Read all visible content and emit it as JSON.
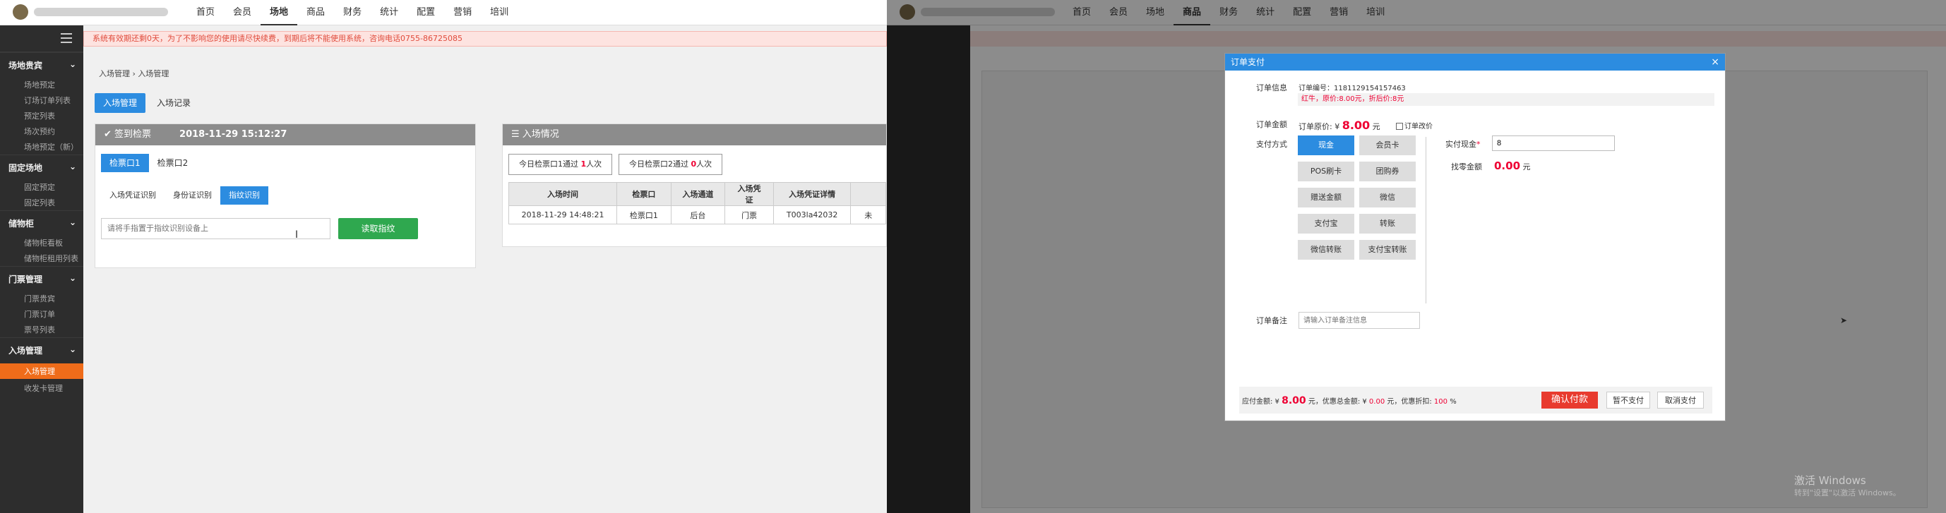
{
  "nav": {
    "items": [
      "首页",
      "会员",
      "场地",
      "商品",
      "财务",
      "统计",
      "配置",
      "营销",
      "培训"
    ],
    "active_left": "场地",
    "active_right": "商品"
  },
  "alert": "系统有效期还剩0天，为了不影响您的使用请尽快续费，到期后将不能使用系统，咨询电话0755-86725085",
  "sidebar": {
    "groups": [
      {
        "title": "场地贵宾",
        "items": [
          "场地预定",
          "订场订单列表",
          "预定列表",
          "场次预约",
          "场地预定（新）"
        ]
      },
      {
        "title": "固定场地",
        "items": [
          "固定预定",
          "固定列表"
        ]
      },
      {
        "title": "储物柜",
        "items": [
          "储物柜看板",
          "储物柜租用列表"
        ]
      },
      {
        "title": "门票管理",
        "items": [
          "门票贵宾",
          "门票订单",
          "票号列表"
        ]
      },
      {
        "title": "入场管理",
        "items": [
          "入场管理",
          "收发卡管理"
        ]
      }
    ],
    "active": "入场管理"
  },
  "breadcrumb": "入场管理 › 入场管理",
  "tabs": [
    "入场管理",
    "入场记录"
  ],
  "check_panel": {
    "title": "签到检票",
    "datetime": "2018-11-29 15:12:27",
    "gates": [
      "检票口1",
      "检票口2"
    ],
    "methods": [
      "入场凭证识别",
      "身份证识别",
      "指纹识别"
    ],
    "placeholder": "请将手指置于指纹识别设备上",
    "read_btn": "读取指纹"
  },
  "entry_panel": {
    "title": "入场情况",
    "stat1": {
      "pre": "今日检票口1通过 ",
      "count": "1",
      "post": "人次"
    },
    "stat2": {
      "pre": "今日检票口2通过 ",
      "count": "0",
      "post": "人次"
    },
    "headers": [
      "入场时间",
      "检票口",
      "入场通道",
      "入场凭证",
      "入场凭证详情"
    ],
    "rows": [
      [
        "2018-11-29 14:48:21",
        "检票口1",
        "后台",
        "门票",
        "T003la42032"
      ]
    ],
    "trail": "未"
  },
  "modal": {
    "title": "订单支付",
    "close": "×",
    "order_info_label": "订单信息",
    "order_no": "订单编号：1181129154157463",
    "discount_line": "红牛，原价:8.00元，折后价:8元",
    "amount_label": "订单金额",
    "amount_pre": "订单原价: ¥ ",
    "amount": "8.00",
    "amount_post": " 元",
    "recount": "订单改价",
    "paymethod_label": "支付方式",
    "methods": [
      "现金",
      "会员卡",
      "POS刷卡",
      "团购券",
      "赠送金额",
      "微信",
      "支付宝",
      "转账",
      "微信转账",
      "支付宝转账"
    ],
    "active_method": "现金",
    "cash_label": "实付现金",
    "cash_value": "8",
    "change_label": "找零金额",
    "change_value": "0.00",
    "change_unit": " 元",
    "memo_label": "订单备注",
    "memo_placeholder": "请输入订单备注信息",
    "footer": {
      "due_pre": "应付金额: ¥ ",
      "due": "8.00",
      "due_post": " 元，优惠总金额: ¥ ",
      "disc": "0.00",
      "disc_post": " 元，优惠折扣: ",
      "rate": "100",
      "rate_post": " %",
      "confirm": "确认付款",
      "later": "暂不支付",
      "cancel": "取消支付"
    }
  },
  "watermark": {
    "line1": "激活 Windows",
    "line2": "转到\"设置\"以激活 Windows。"
  }
}
